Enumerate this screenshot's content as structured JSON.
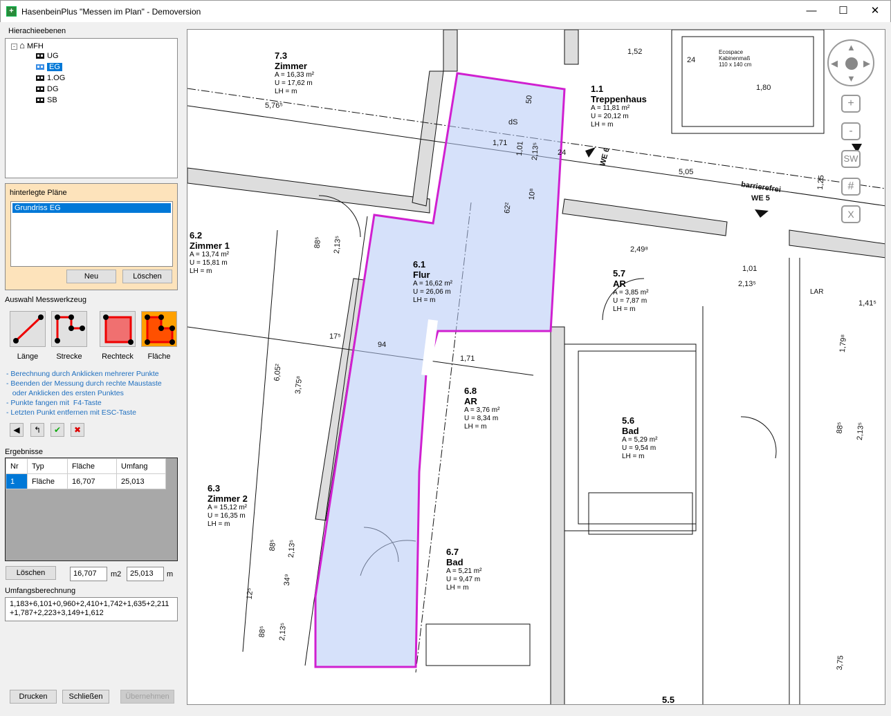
{
  "window": {
    "title": "HasenbeinPlus \"Messen im Plan\" - Demoversion",
    "minimize": "—",
    "maximize": "☐",
    "close": "✕"
  },
  "hierarchy": {
    "label": "Hierachieebenen",
    "root": "MFH",
    "items": [
      "UG",
      "EG",
      "1.OG",
      "DG",
      "SB"
    ],
    "selected": "EG"
  },
  "plans": {
    "label": "hinterlegte Pläne",
    "items": [
      "Grundriss EG"
    ],
    "new": "Neu",
    "delete": "Löschen"
  },
  "tools": {
    "label": "Auswahl Messwerkzeug",
    "items": [
      "Länge",
      "Strecke",
      "Rechteck",
      "Fläche"
    ],
    "selected": "Fläche"
  },
  "hints": [
    "- Berechnung durch Anklicken mehrerer Punkte",
    "- Beenden der Messung durch rechte Maustaste",
    "   oder Anklicken des ersten Punktes",
    "- Punkte fangen mit  F4-Taste",
    "- Letzten Punkt entfernen mit ESC-Taste"
  ],
  "results": {
    "label": "Ergebnisse",
    "columns": [
      "Nr",
      "Typ",
      "Fläche",
      "Umfang"
    ],
    "rows": [
      [
        "1",
        "Fläche",
        "16,707",
        "25,013"
      ]
    ],
    "delete": "Löschen",
    "area": "16,707",
    "area_unit": "m2",
    "perimeter": "25,013",
    "perimeter_unit": "m"
  },
  "perimeter_calc": {
    "label": "Umfangsberechnung",
    "text": "1,183+6,101+0,960+2,410+1,742+1,635+2,211 +1,787+2,223+3,149+1,612"
  },
  "footer": {
    "print": "Drucken",
    "close": "Schließen",
    "apply": "Übernehmen"
  },
  "nav": {
    "zoom_in": "+",
    "zoom_out": "-",
    "sw": "SW",
    "grid": "#",
    "close": "X"
  },
  "rooms": [
    {
      "num": "7.3",
      "name": "Zimmer",
      "a": "A = 16,33 m²",
      "u": "U = 17,62 m",
      "lh": "LH =  m"
    },
    {
      "num": "1.1",
      "name": "Treppenhaus",
      "a": "A = 11,81 m²",
      "u": "U = 20,12 m",
      "lh": "LH =  m"
    },
    {
      "num": "6.2",
      "name": "Zimmer 1",
      "a": "A = 13,74 m²",
      "u": "U = 15,81 m",
      "lh": "LH =  m"
    },
    {
      "num": "6.1",
      "name": "Flur",
      "a": "A = 16,62 m²",
      "u": "U = 26,06 m",
      "lh": "LH =  m"
    },
    {
      "num": "5.7",
      "name": "AR",
      "a": "A = 3,85 m²",
      "u": "U = 7,87 m",
      "lh": "LH =  m"
    },
    {
      "num": "6.8",
      "name": "AR",
      "a": "A = 3,76 m²",
      "u": "U = 8,34 m",
      "lh": "LH =  m"
    },
    {
      "num": "5.6",
      "name": "Bad",
      "a": "A = 5,29 m²",
      "u": "U = 9,54 m",
      "lh": "LH =  m"
    },
    {
      "num": "6.3",
      "name": "Zimmer 2",
      "a": "A = 15,12 m²",
      "u": "U = 16,35 m",
      "lh": "LH =  m"
    },
    {
      "num": "6.7",
      "name": "Bad",
      "a": "A = 5,21 m²",
      "u": "U = 9,47 m",
      "lh": "LH =  m"
    },
    {
      "num": "5.5",
      "name": "",
      "a": "",
      "u": "",
      "lh": ""
    }
  ],
  "plan_labels": {
    "we6": "WE 6",
    "we5": "WE 5",
    "barrierefrei": "barrierefrei",
    "lar": "LAR",
    "ecospace": "Ecospace Kabinenmaß 110 x 140 cm",
    "ds": "dS"
  },
  "dims": [
    "1,52",
    "24",
    "1,80",
    "5,76⁵",
    "1,71",
    "1,01",
    "2,13⁵",
    "5,05",
    "1,25",
    "24",
    "50",
    "10⁸",
    "62²",
    "2,49⁸",
    "1,01",
    "2,13⁵",
    "1,41⁵",
    "88⁵",
    "2,13⁵",
    "94",
    "1,71",
    "17⁵",
    "6,05²",
    "3,75⁸",
    "88⁵",
    "2,13⁵",
    "34⁹",
    "12⁵",
    "88⁵",
    "2,13⁵",
    "1,79⁸",
    "88⁵",
    "2,13⁵",
    "3,75"
  ]
}
